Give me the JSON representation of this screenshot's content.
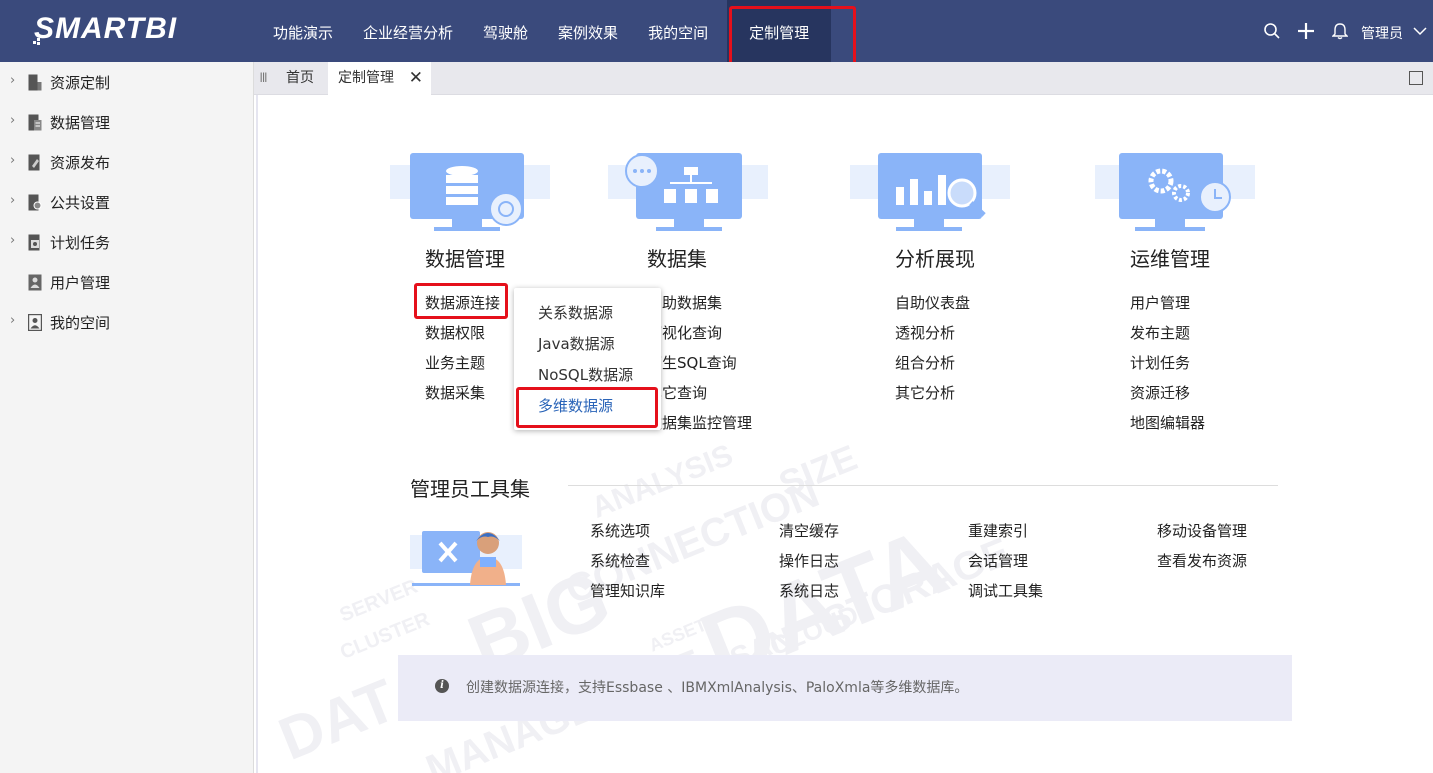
{
  "app": {
    "logo": "SMARTBI",
    "nav": [
      "功能演示",
      "企业经营分析",
      "驾驶舱",
      "案例效果",
      "我的空间",
      "定制管理"
    ],
    "user": "管理员"
  },
  "sidebar": {
    "items": [
      {
        "label": "资源定制",
        "icon": "resource-custom-icon",
        "expandable": true
      },
      {
        "label": "数据管理",
        "icon": "data-manage-icon",
        "expandable": true
      },
      {
        "label": "资源发布",
        "icon": "publish-icon",
        "expandable": true
      },
      {
        "label": "公共设置",
        "icon": "settings-icon",
        "expandable": true
      },
      {
        "label": "计划任务",
        "icon": "schedule-icon",
        "expandable": true
      },
      {
        "label": "用户管理",
        "icon": "user-manage-icon",
        "expandable": false
      },
      {
        "label": "我的空间",
        "icon": "my-space-icon",
        "expandable": true
      }
    ]
  },
  "tabs": {
    "home": "首页",
    "active": "定制管理",
    "close": "✕"
  },
  "modules": [
    {
      "title": "数据管理",
      "links": [
        "数据源连接",
        "数据权限",
        "业务主题",
        "数据采集"
      ]
    },
    {
      "title": "数据集",
      "links": [
        "自助数据集",
        "可视化查询",
        "原生SQL查询",
        "其它查询",
        "数据集监控管理"
      ]
    },
    {
      "title": "分析展现",
      "links": [
        "自助仪表盘",
        "透视分析",
        "组合分析",
        "其它分析"
      ]
    },
    {
      "title": "运维管理",
      "links": [
        "用户管理",
        "发布主题",
        "计划任务",
        "资源迁移",
        "地图编辑器"
      ]
    }
  ],
  "dropdown": {
    "items": [
      "关系数据源",
      "Java数据源",
      "NoSQL数据源",
      "多维数据源"
    ],
    "selected": "多维数据源"
  },
  "admin_tools": {
    "title": "管理员工具集",
    "columns": [
      [
        "系统选项",
        "系统检查",
        "管理知识库"
      ],
      [
        "清空缓存",
        "操作日志",
        "系统日志"
      ],
      [
        "重建索引",
        "会话管理",
        "调试工具集"
      ],
      [
        "移动设备管理",
        "查看发布资源"
      ]
    ]
  },
  "info": {
    "icon": "i",
    "text": "创建数据源连接，支持Essbase 、IBMXmlAnalysis、PaloXmla等多维数据库。"
  },
  "watermark": {
    "words": [
      "ANALYSIS",
      "SIZE",
      "CONNECTION",
      "DATA",
      "BIG",
      "STORAGE",
      "CLUSTER",
      "SERVER",
      "DAT",
      "ASSET",
      "MANAGEMENT",
      "CLOUD",
      "HUSAN"
    ]
  },
  "colors": {
    "topbar": "#3a4a7c",
    "nav_active": "#27355f",
    "highlight": "#e5101b",
    "illustration": "#8ab4f8",
    "info_bg": "#ebebf7"
  }
}
